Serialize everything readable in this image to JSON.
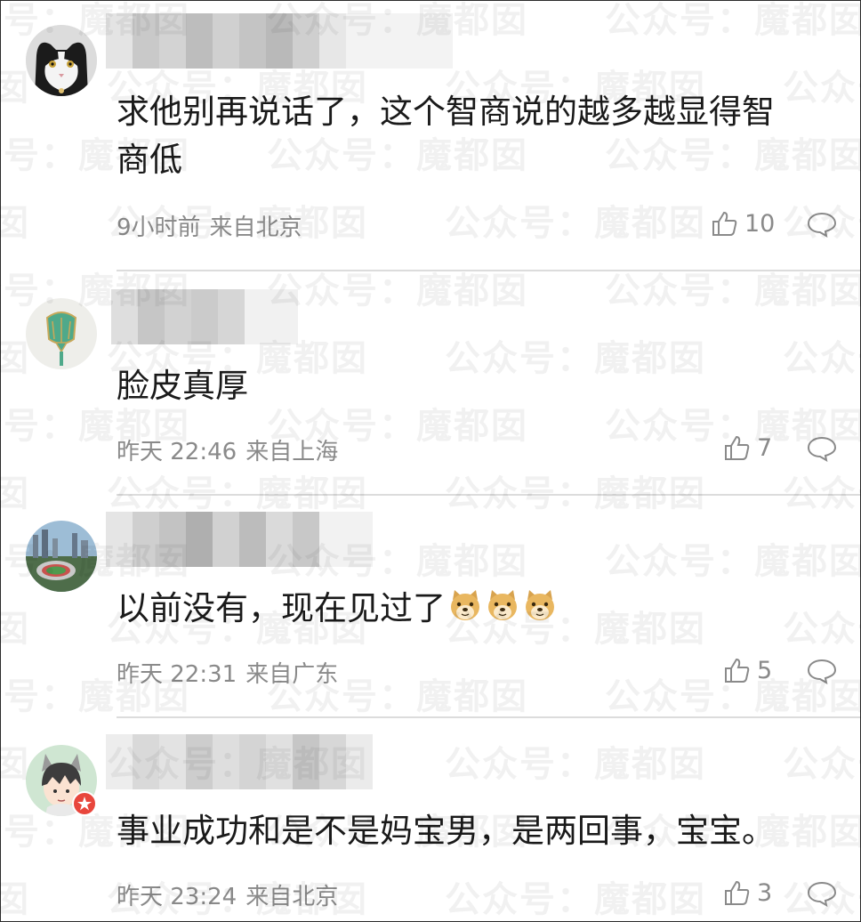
{
  "comments": [
    {
      "avatar": "cat-avatar",
      "text_line1": "求他别再说话了，这个智商说的越多越显得智",
      "text_line2": "商低",
      "time": "9小时前",
      "location": "来自北京",
      "likes": "10"
    },
    {
      "avatar": "horseshoe-crab-pin-avatar",
      "text_line1": "脸皮真厚",
      "time": "昨天 22:46",
      "location": "来自上海",
      "likes": "7"
    },
    {
      "avatar": "stadium-avatar",
      "text_line1": "以前没有，现在见过了",
      "emoji": [
        "doge-emoji",
        "doge-emoji",
        "doge-emoji"
      ],
      "time": "昨天 22:31",
      "location": "来自广东",
      "likes": "5"
    },
    {
      "avatar": "anime-boy-avatar",
      "text_line1": "事业成功和是不是妈宝男，是两回事，宝宝。",
      "time": "昨天 23:24",
      "location": "来自北京",
      "likes": "3"
    }
  ],
  "watermark_text": "公众号：魔都囡",
  "icons": {
    "like": "thumbs-up-icon",
    "reply": "comment-bubble-icon"
  },
  "colors": {
    "text": "#1a1a1a",
    "meta": "#8a8a8a",
    "divider": "#dcdcdc"
  }
}
